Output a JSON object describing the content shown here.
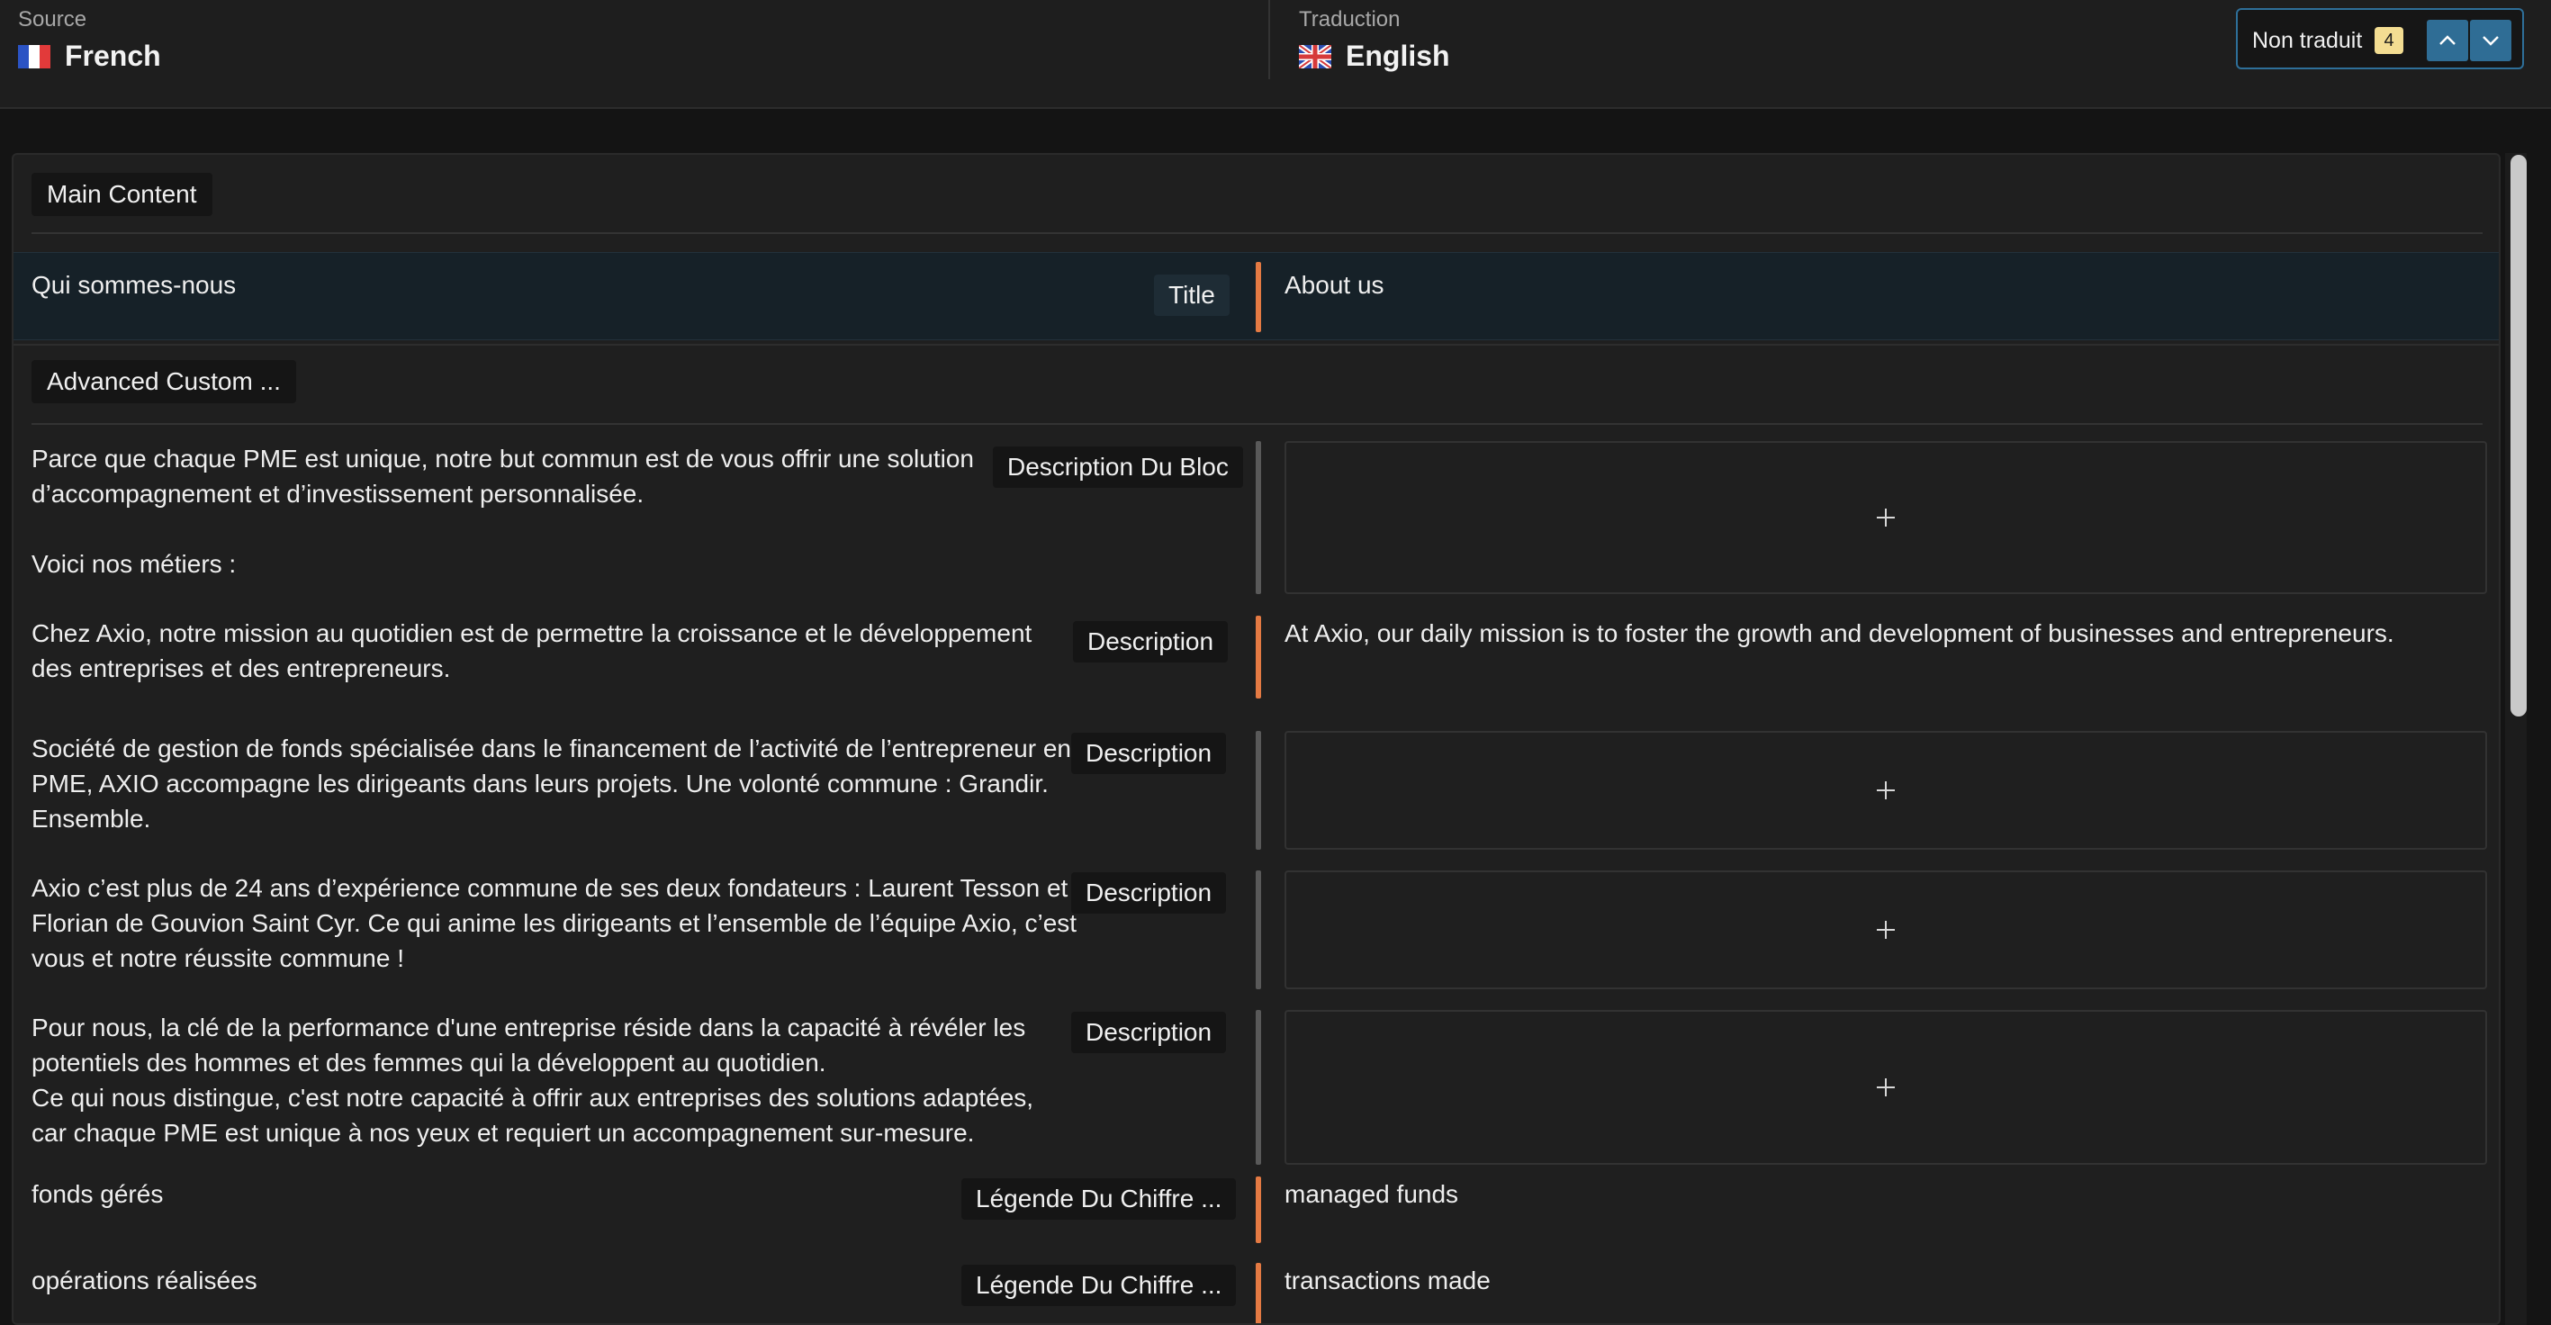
{
  "header": {
    "source": {
      "caption": "Source",
      "language": "French",
      "flag_icon": "france-flag-icon"
    },
    "target": {
      "caption": "Traduction",
      "language": "English",
      "flag_icon": "uk-flag-icon"
    },
    "filter": {
      "label": "Non traduit",
      "count": "4"
    }
  },
  "sections": [
    {
      "label": "Main Content"
    },
    {
      "label": "Advanced Custom ..."
    }
  ],
  "rows": [
    {
      "source_lines": [
        "Qui sommes-nous"
      ],
      "field": "Title",
      "translation": "About us",
      "state": "translated",
      "selected": true
    },
    {
      "source_lines": [
        "Parce que chaque PME est unique, notre but commun est de vous offrir une solution",
        "d’accompagnement et d’investissement personnalisée.",
        "",
        "Voici nos métiers :"
      ],
      "field": "Description Du Bloc",
      "translation": "",
      "state": "empty"
    },
    {
      "source_lines": [
        "Chez Axio, notre mission au quotidien est de permettre la croissance et le développement",
        "des entreprises et des entrepreneurs."
      ],
      "field": "Description",
      "translation": "At Axio, our daily mission is to foster the growth and development of businesses and entrepreneurs.",
      "state": "translated"
    },
    {
      "source_lines": [
        "Société de gestion de fonds spécialisée dans le financement de l’activité de l’entrepreneur en",
        "PME, AXIO accompagne les dirigeants dans leurs projets. Une volonté commune : Grandir.",
        "Ensemble."
      ],
      "field": "Description",
      "translation": "",
      "state": "empty"
    },
    {
      "source_lines": [
        "Axio c’est plus de 24 ans d’expérience commune de ses deux fondateurs : Laurent Tesson et",
        "Florian de Gouvion Saint Cyr. Ce qui anime les dirigeants et l’ensemble de l’équipe Axio, c’est",
        "vous et notre réussite commune !"
      ],
      "field": "Description",
      "translation": "",
      "state": "empty"
    },
    {
      "source_lines": [
        "Pour nous, la clé de la performance d'une entreprise réside dans la capacité à révéler les",
        "potentiels des hommes et des femmes qui la développent au quotidien.",
        "Ce qui nous distingue, c'est notre capacité à offrir aux entreprises des solutions adaptées,",
        "car chaque PME est unique à nos yeux et requiert un accompagnement sur-mesure."
      ],
      "field": "Description",
      "translation": "",
      "state": "empty"
    },
    {
      "source_lines": [
        "fonds gérés"
      ],
      "field": "Légende Du Chiffre ...",
      "translation": "managed funds",
      "state": "translated"
    },
    {
      "source_lines": [
        "opérations réalisées"
      ],
      "field": "Légende Du Chiffre ...",
      "translation": "transactions made",
      "state": "translated"
    }
  ],
  "colors": {
    "translated_marker": "#e47a43",
    "empty_marker": "#595959",
    "accent": "#2f6d95",
    "count_badge": "#f3dd92"
  }
}
